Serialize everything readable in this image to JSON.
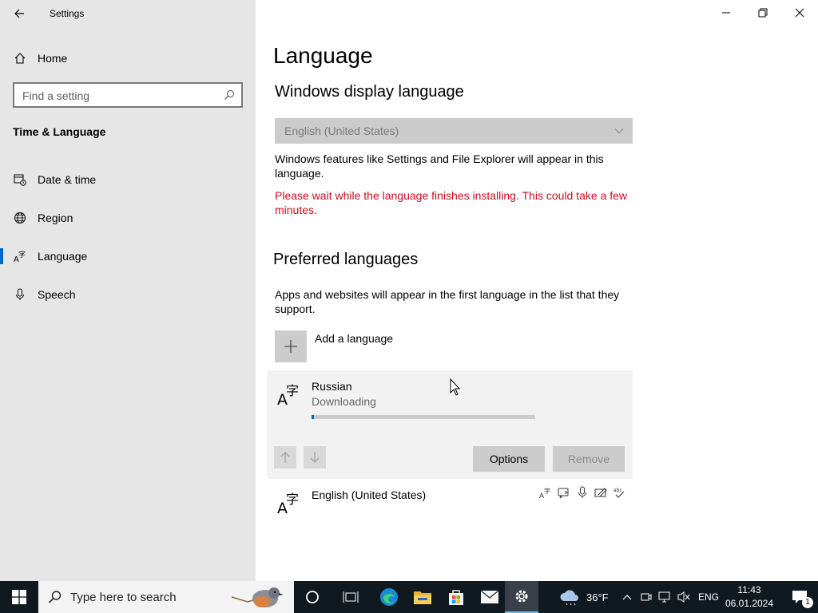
{
  "window": {
    "title": "Settings"
  },
  "sidebar": {
    "home_label": "Home",
    "search_placeholder": "Find a setting",
    "section_title": "Time & Language",
    "items": [
      {
        "label": "Date & time",
        "icon": "calendar-clock-icon"
      },
      {
        "label": "Region",
        "icon": "globe-icon"
      },
      {
        "label": "Language",
        "icon": "language-icon",
        "active": true
      },
      {
        "label": "Speech",
        "icon": "microphone-icon"
      }
    ]
  },
  "main": {
    "page_title": "Language",
    "display_language": {
      "heading": "Windows display language",
      "selected": "English (United States)",
      "description": "Windows features like Settings and File Explorer will appear in this language.",
      "warning": "Please wait while the language finishes installing. This could take a few minutes."
    },
    "preferred": {
      "heading": "Preferred languages",
      "description": "Apps and websites will appear in the first language in the list that they support.",
      "add_label": "Add a language",
      "languages": [
        {
          "name": "Russian",
          "status": "Downloading",
          "progress": 0.01,
          "options_label": "Options",
          "remove_label": "Remove"
        },
        {
          "name": "English (United States)",
          "features": [
            "display-language-icon",
            "text-to-speech-icon",
            "speech-recognition-icon",
            "handwriting-icon",
            "spellcheck-icon"
          ]
        }
      ]
    }
  },
  "taskbar": {
    "search_placeholder": "Type here to search",
    "weather": "36°F",
    "language": "ENG",
    "time": "11:43",
    "date": "06.01.2024",
    "notification_count": "1"
  },
  "colors": {
    "accent": "#0067c0",
    "warning": "#c50f1f",
    "sidebar_bg": "#e6e6e6",
    "taskbar_bg": "#101820"
  }
}
